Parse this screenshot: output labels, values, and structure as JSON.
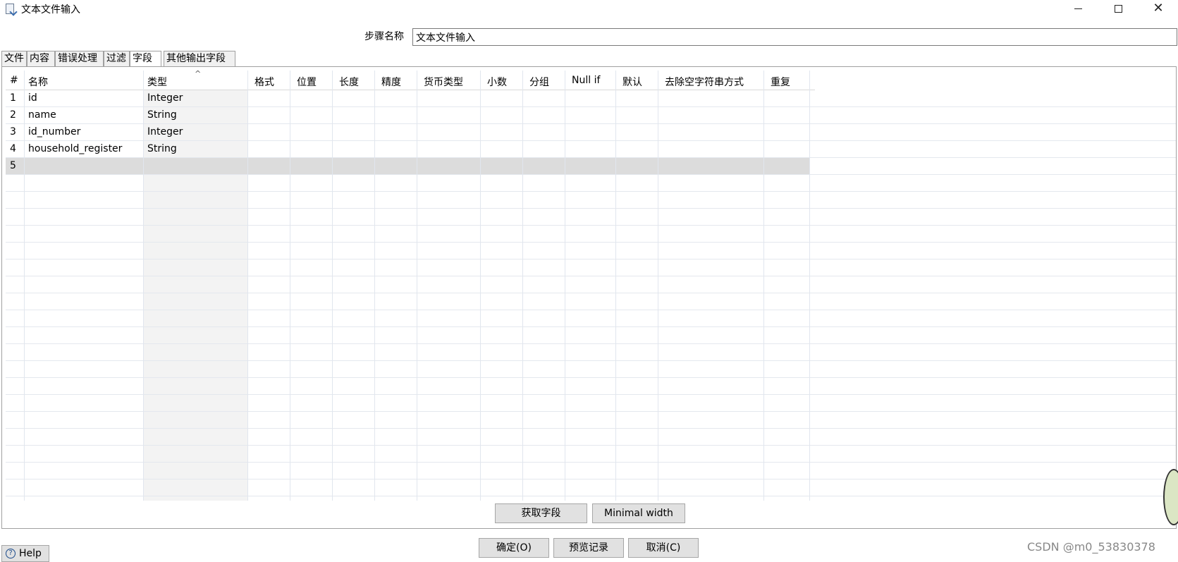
{
  "window": {
    "title": "文本文件输入"
  },
  "step": {
    "label": "步骤名称",
    "value": "文本文件输入"
  },
  "tabs": [
    {
      "label": "文件"
    },
    {
      "label": "内容"
    },
    {
      "label": "错误处理"
    },
    {
      "label": "过滤"
    },
    {
      "label": "字段",
      "active": true
    },
    {
      "label": "其他输出字段"
    }
  ],
  "table": {
    "headers": [
      "#",
      "名称",
      "类型",
      "格式",
      "位置",
      "长度",
      "精度",
      "货币类型",
      "小数",
      "分组",
      "Null if",
      "默认",
      "去除空字符串方式",
      "重复"
    ],
    "sorted_column": "类型",
    "rows": [
      {
        "num": "1",
        "name": "id",
        "type": "Integer"
      },
      {
        "num": "2",
        "name": "name",
        "type": "String"
      },
      {
        "num": "3",
        "name": "id_number",
        "type": "Integer"
      },
      {
        "num": "4",
        "name": "household_register",
        "type": "String"
      },
      {
        "num": "5",
        "name": "",
        "type": ""
      }
    ],
    "selected_row": "5"
  },
  "panel_buttons": {
    "get_fields": "获取字段",
    "minimal_width": "Minimal width"
  },
  "footer_buttons": {
    "ok": "确定(O)",
    "preview": "预览记录",
    "cancel": "取消(C)",
    "help": "Help"
  },
  "watermark": "CSDN @m0_53830378"
}
